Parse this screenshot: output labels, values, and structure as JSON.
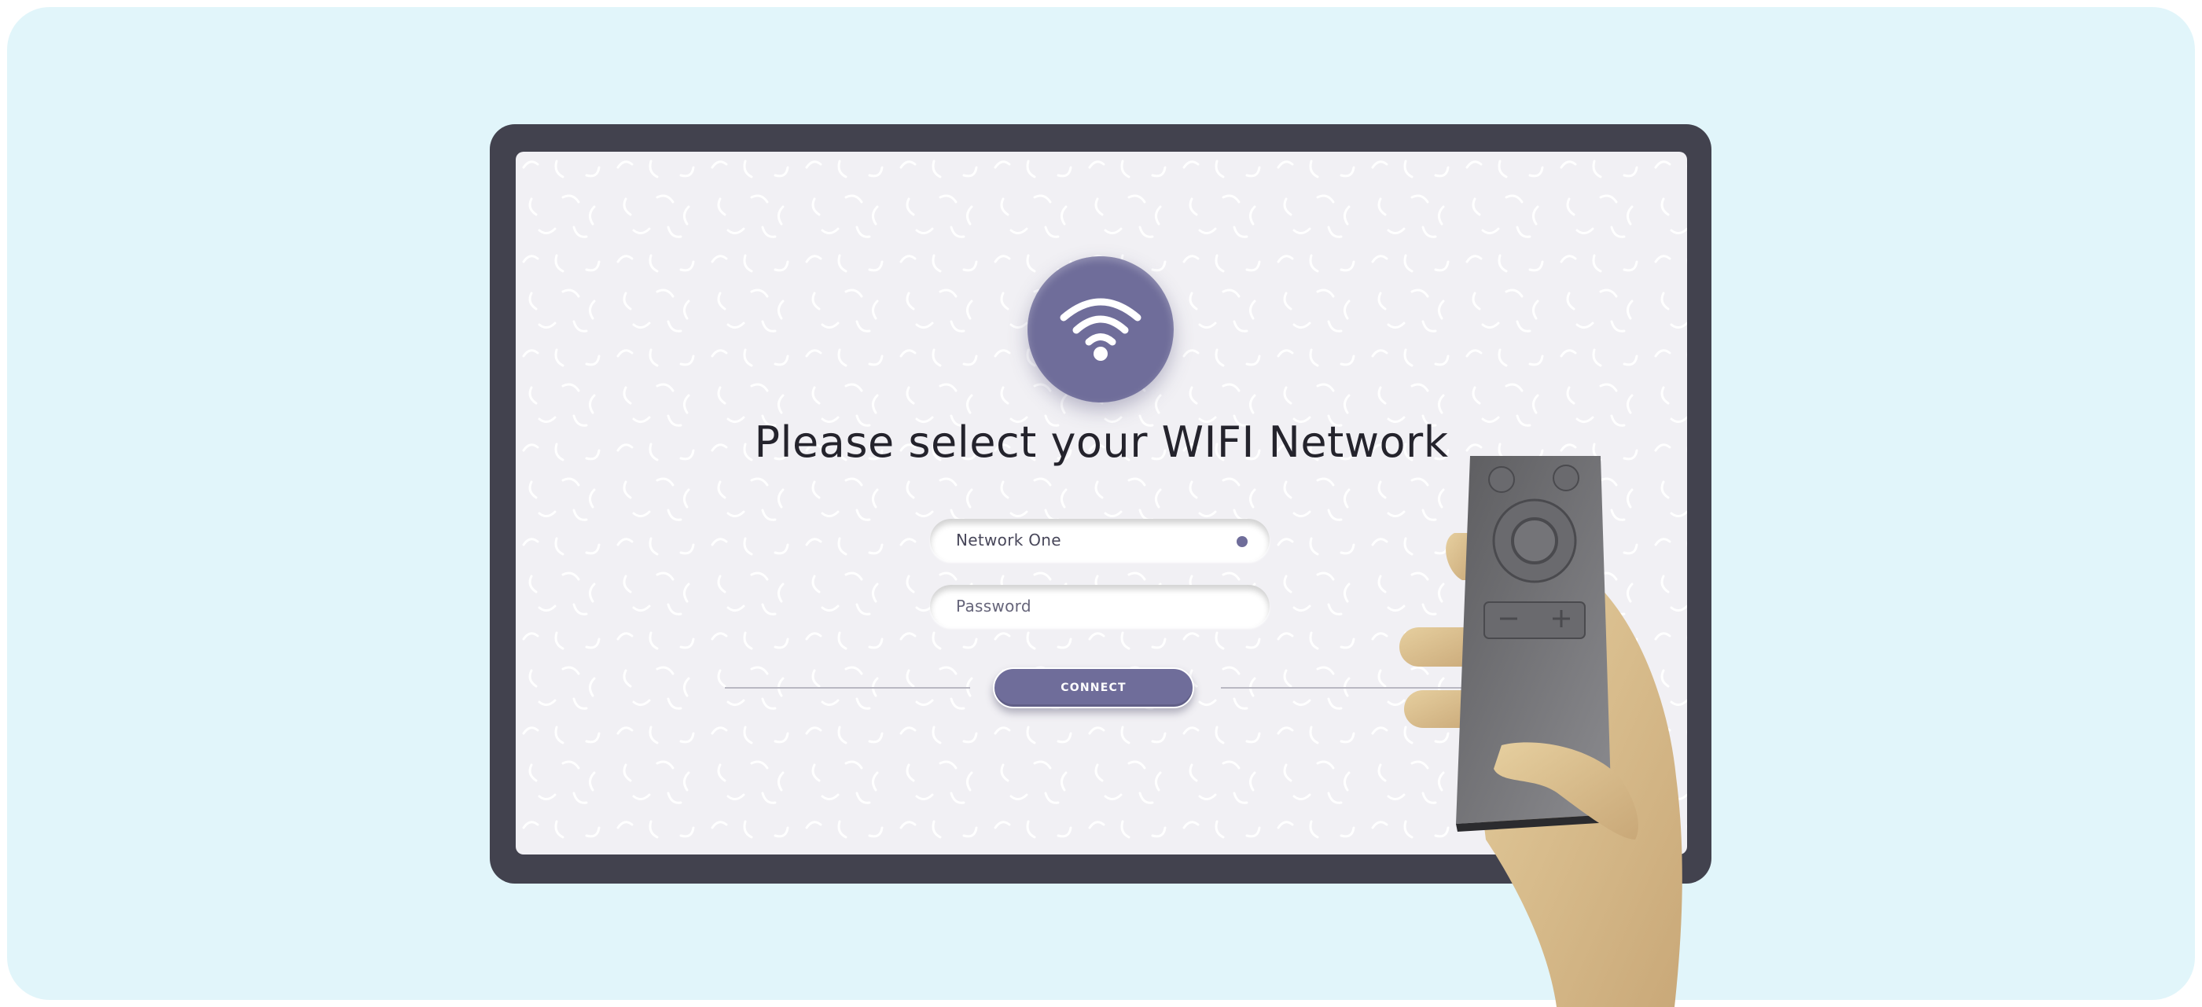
{
  "screen": {
    "title": "Please select your WIFI Network",
    "network_field": {
      "value": "Network One"
    },
    "password_field": {
      "placeholder": "Password"
    },
    "connect_button": {
      "label": "CONNECT"
    }
  },
  "icons": {
    "wifi": "wifi-icon",
    "status": "status-dot-icon",
    "remote": "tv-remote-icon"
  },
  "colors": {
    "backdrop": "#e1f5fa",
    "tv_frame": "#42424e",
    "screen_background": "#f1f0f4",
    "accent": "#6f6d9a",
    "title_text": "#24232c"
  }
}
